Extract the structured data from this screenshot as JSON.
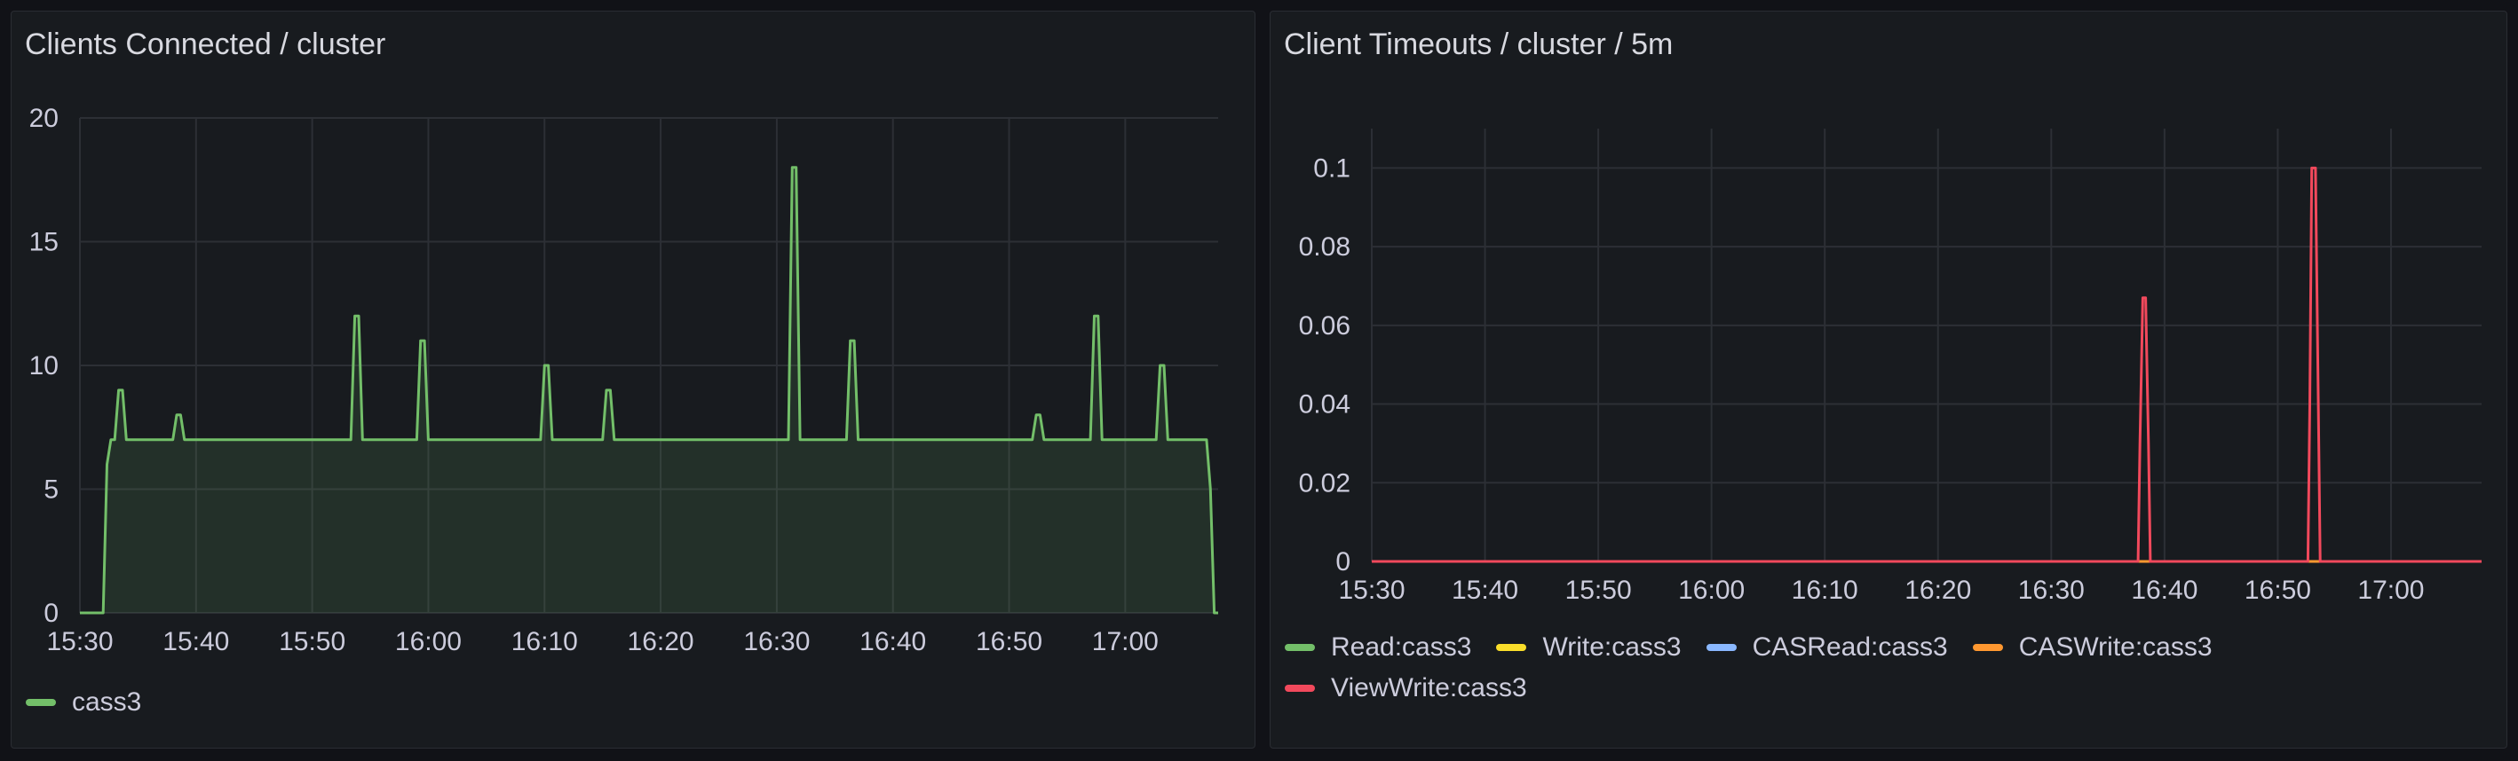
{
  "colors": {
    "cass3": "#73bf69",
    "read": "#73bf69",
    "write": "#fade2a",
    "casread": "#8ab8ff",
    "caswrite": "#ff9830",
    "viewwrite": "#f2495c"
  },
  "chart_data": [
    {
      "type": "area",
      "title": "Clients Connected / cluster",
      "xlabel": "",
      "ylabel": "",
      "x_ticks": [
        "15:30",
        "15:40",
        "15:50",
        "16:00",
        "16:10",
        "16:20",
        "16:30",
        "16:40",
        "16:50",
        "17:00"
      ],
      "y_ticks": [
        "0",
        "5",
        "10",
        "15",
        "20"
      ],
      "xlim": [
        "15:30",
        "17:08"
      ],
      "ylim": [
        0,
        20
      ],
      "grid": true,
      "legend_position": "bottom-left",
      "series": [
        {
          "name": "cass3",
          "color": "#73bf69",
          "points": [
            [
              "15:30",
              0
            ],
            [
              "15:32",
              0
            ],
            [
              "15:32:20",
              6
            ],
            [
              "15:32:40",
              7
            ],
            [
              "15:33",
              7
            ],
            [
              "15:33:20",
              9
            ],
            [
              "15:33:40",
              9
            ],
            [
              "15:34",
              7
            ],
            [
              "15:38",
              7
            ],
            [
              "15:38:20",
              8
            ],
            [
              "15:38:40",
              8
            ],
            [
              "15:39",
              7
            ],
            [
              "15:53:20",
              7
            ],
            [
              "15:53:40",
              12
            ],
            [
              "15:54",
              12
            ],
            [
              "15:54:20",
              7
            ],
            [
              "15:59",
              7
            ],
            [
              "15:59:20",
              11
            ],
            [
              "15:59:40",
              11
            ],
            [
              "16:00",
              7
            ],
            [
              "16:09:40",
              7
            ],
            [
              "16:10",
              10
            ],
            [
              "16:10:20",
              10
            ],
            [
              "16:10:40",
              7
            ],
            [
              "16:15",
              7
            ],
            [
              "16:15:20",
              9
            ],
            [
              "16:15:40",
              9
            ],
            [
              "16:16",
              7
            ],
            [
              "16:31",
              7
            ],
            [
              "16:31:20",
              18
            ],
            [
              "16:31:40",
              18
            ],
            [
              "16:32",
              7
            ],
            [
              "16:36",
              7
            ],
            [
              "16:36:20",
              11
            ],
            [
              "16:36:40",
              11
            ],
            [
              "16:37",
              7
            ],
            [
              "16:52",
              7
            ],
            [
              "16:52:20",
              8
            ],
            [
              "16:52:40",
              8
            ],
            [
              "16:53",
              7
            ],
            [
              "16:57",
              7
            ],
            [
              "16:57:20",
              12
            ],
            [
              "16:57:40",
              12
            ],
            [
              "16:58",
              7
            ],
            [
              "17:02:40",
              7
            ],
            [
              "17:03",
              10
            ],
            [
              "17:03:20",
              10
            ],
            [
              "17:03:40",
              7
            ],
            [
              "17:07",
              7
            ],
            [
              "17:07:20",
              5
            ],
            [
              "17:07:40",
              0
            ],
            [
              "17:08",
              0
            ]
          ]
        }
      ]
    },
    {
      "type": "line",
      "title": "Client Timeouts / cluster / 5m",
      "xlabel": "",
      "ylabel": "",
      "x_ticks": [
        "15:30",
        "15:40",
        "15:50",
        "16:00",
        "16:10",
        "16:20",
        "16:30",
        "16:40",
        "16:50",
        "17:00"
      ],
      "y_ticks": [
        "0",
        "0.02",
        "0.04",
        "0.06",
        "0.08",
        "0.1"
      ],
      "xlim": [
        "15:30",
        "17:08"
      ],
      "ylim": [
        0,
        0.11
      ],
      "grid": true,
      "legend_position": "bottom-left",
      "series": [
        {
          "name": "Read:cass3",
          "color": "#73bf69",
          "points": [
            [
              "15:30",
              0
            ],
            [
              "17:08",
              0
            ]
          ]
        },
        {
          "name": "Write:cass3",
          "color": "#fade2a",
          "points": [
            [
              "15:30",
              0
            ],
            [
              "17:08",
              0
            ]
          ]
        },
        {
          "name": "CASRead:cass3",
          "color": "#8ab8ff",
          "points": [
            [
              "15:30",
              0
            ],
            [
              "17:08",
              0
            ]
          ]
        },
        {
          "name": "CASWrite:cass3",
          "color": "#ff9830",
          "points": [
            [
              "15:30",
              0
            ],
            [
              "17:08",
              0
            ]
          ]
        },
        {
          "name": "ViewWrite:cass3",
          "color": "#f2495c",
          "points": [
            [
              "15:30",
              0
            ],
            [
              "16:37:40",
              0
            ],
            [
              "16:37:50",
              0.03
            ],
            [
              "16:38:05",
              0.067
            ],
            [
              "16:38:20",
              0.067
            ],
            [
              "16:38:35",
              0.03
            ],
            [
              "16:38:45",
              0
            ],
            [
              "16:52:40",
              0
            ],
            [
              "16:52:50",
              0.04
            ],
            [
              "16:53:00",
              0.1
            ],
            [
              "16:53:20",
              0.1
            ],
            [
              "16:53:35",
              0.04
            ],
            [
              "16:53:45",
              0
            ],
            [
              "17:08",
              0
            ]
          ]
        }
      ]
    }
  ]
}
